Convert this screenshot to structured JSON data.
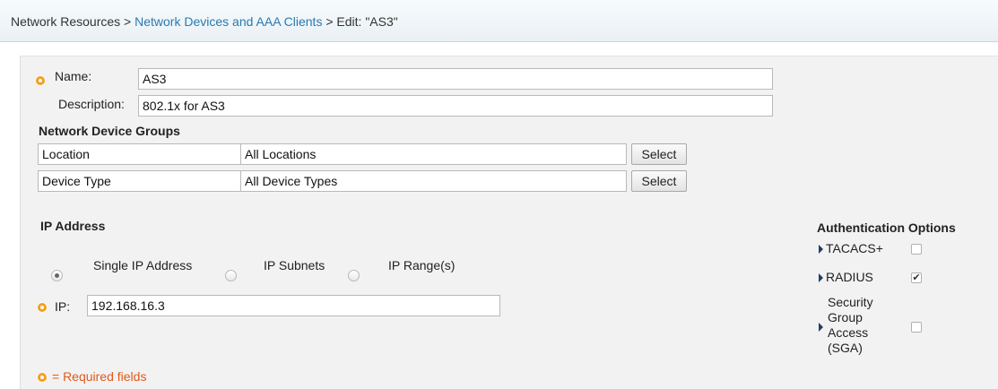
{
  "breadcrumb": {
    "root": "Network Resources",
    "sep1": ">",
    "link": "Network Devices and AAA Clients",
    "sep2": ">",
    "current": "Edit: \"AS3\""
  },
  "form": {
    "name_label": "Name:",
    "name_value": "AS3",
    "description_label": "Description:",
    "description_value": "802.1x for AS3"
  },
  "ndg": {
    "title": "Network Device Groups",
    "rows": [
      {
        "group": "Location",
        "value": "All Locations",
        "button": "Select"
      },
      {
        "group": "Device Type",
        "value": "All Device Types",
        "button": "Select"
      }
    ]
  },
  "ip": {
    "title": "IP Address",
    "options": [
      {
        "label": "Single IP Address",
        "selected": true
      },
      {
        "label": "IP Subnets",
        "selected": false
      },
      {
        "label": "IP Range(s)",
        "selected": false
      }
    ],
    "ip_label": "IP:",
    "ip_value": "192.168.16.3"
  },
  "auth": {
    "title": "Authentication Options",
    "items": [
      {
        "label": "TACACS+",
        "checked": false
      },
      {
        "label": "RADIUS",
        "checked": true
      },
      {
        "label": "Security Group Access (SGA)",
        "checked": false
      }
    ],
    "sga_lines": [
      "Security",
      "Group",
      "Access",
      "(SGA)"
    ]
  },
  "footer": {
    "required_note": "= Required fields"
  },
  "colors": {
    "link": "#2a7ab0",
    "required": "#f0a020",
    "required_text": "#e05a1c"
  }
}
